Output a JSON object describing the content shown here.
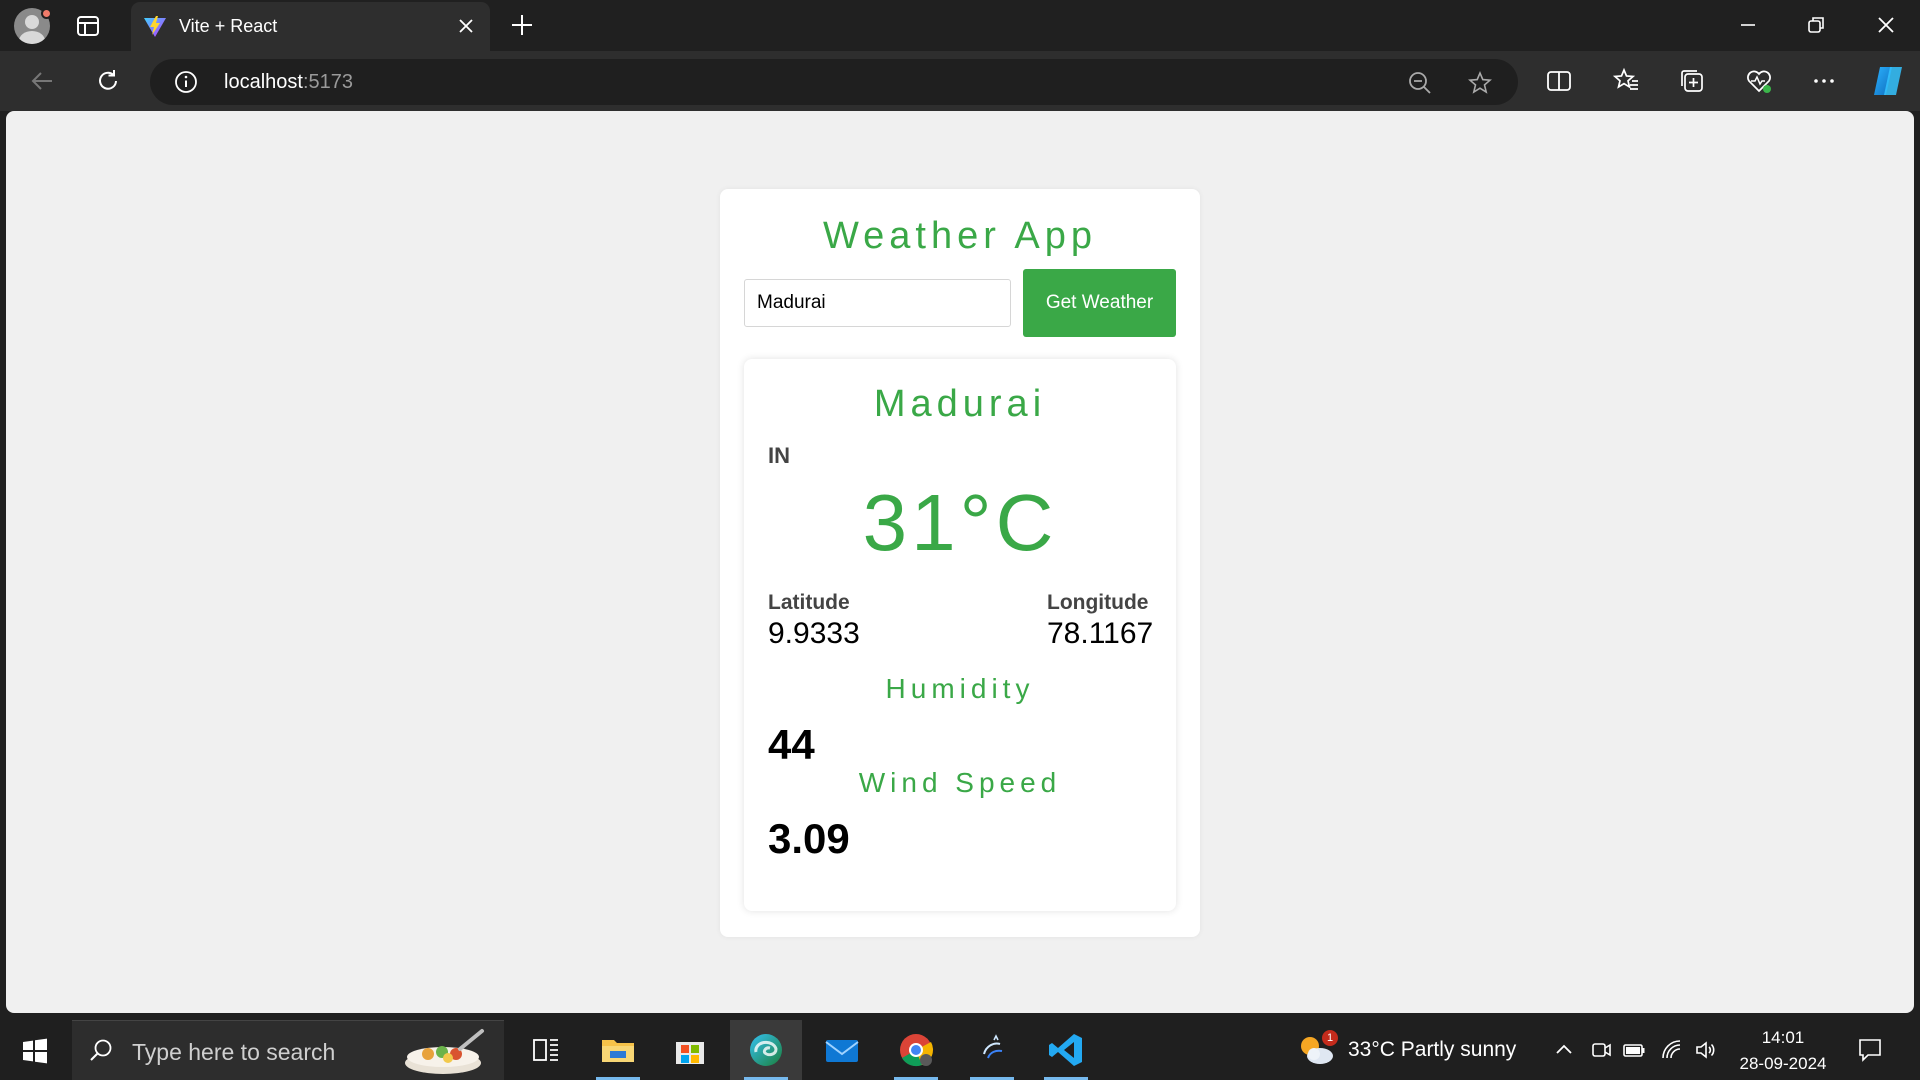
{
  "browser": {
    "tab_title": "Vite + React",
    "url_host": "localhost",
    "url_port": ":5173"
  },
  "app": {
    "title": "Weather App",
    "input_value": "Madurai",
    "button_label": "Get Weather"
  },
  "weather": {
    "city": "Madurai",
    "country": "IN",
    "temperature": "31°C",
    "latitude_label": "Latitude",
    "latitude": "9.9333",
    "longitude_label": "Longitude",
    "longitude": "78.1167",
    "humidity_label": "Humidity",
    "humidity": "44",
    "wind_label": "Wind Speed",
    "wind": "3.09"
  },
  "taskbar": {
    "search_placeholder": "Type here to search",
    "weather_text": "33°C  Partly sunny",
    "weather_badge": "1",
    "time": "14:01",
    "date": "28-09-2024"
  },
  "colors": {
    "accent_green": "#3aa847",
    "browser_dark": "#202020",
    "page_bg": "#f0f0f0"
  }
}
